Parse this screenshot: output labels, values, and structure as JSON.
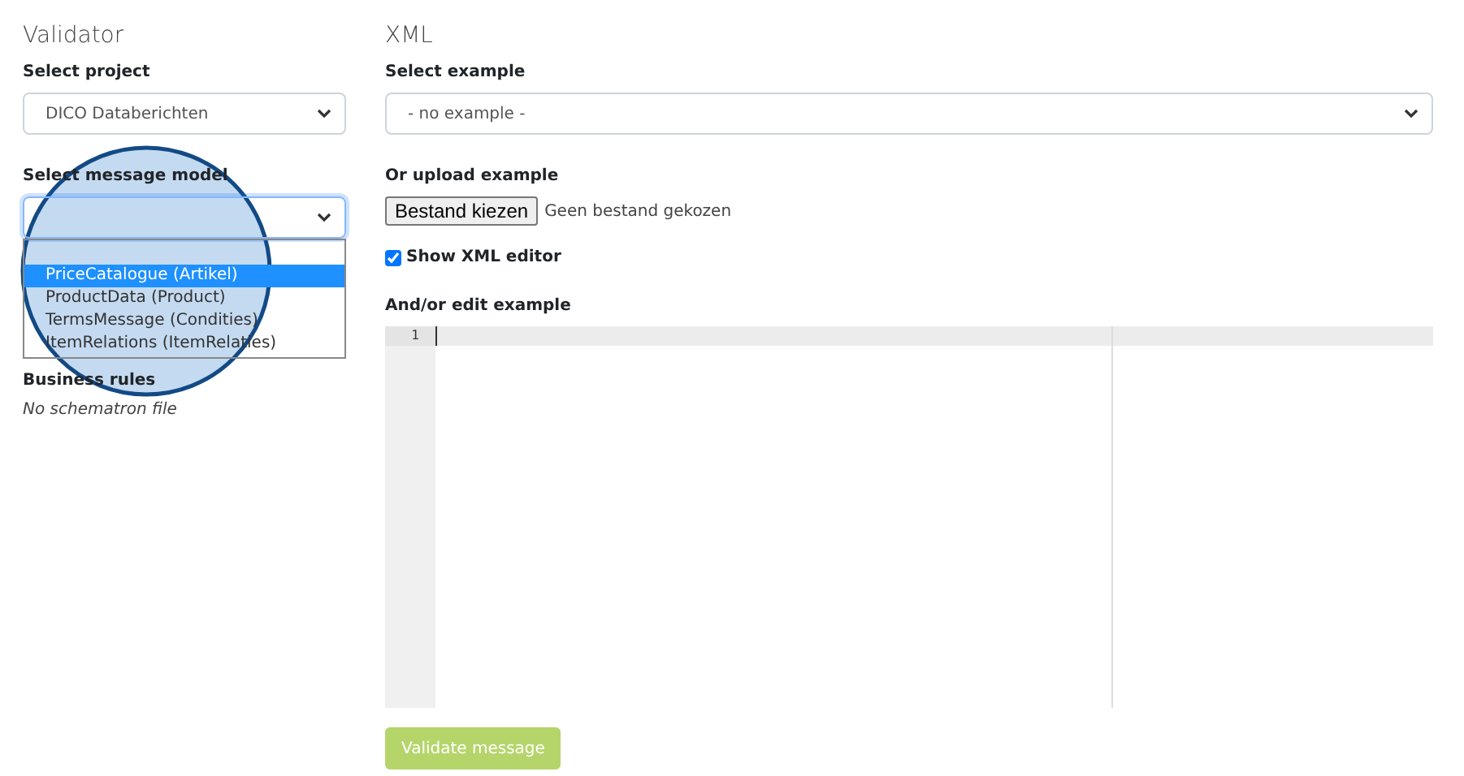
{
  "validator": {
    "title": "Validator",
    "project": {
      "label": "Select project",
      "value": "DICO Databerichten"
    },
    "message_model": {
      "label": "Select message model",
      "expanded": true,
      "options": [
        {
          "selected": false
        },
        {
          "label": "PriceCatalogue (Artikel)",
          "selected": true
        },
        {
          "label": "ProductData (Product)",
          "selected": false
        },
        {
          "label": "TermsMessage (Condities)",
          "selected": false
        },
        {
          "label": "ItemRelations (ItemRelaties)",
          "selected": false
        }
      ]
    },
    "business_rules": {
      "label": "Business rules",
      "value": "No schematron file"
    }
  },
  "xml": {
    "title": "XML",
    "example": {
      "label": "Select example",
      "value": "- no example -"
    },
    "upload": {
      "label": "Or upload example",
      "button": "Bestand kiezen",
      "status": "Geen bestand gekozen"
    },
    "show_editor": {
      "label": "Show XML editor",
      "checked": true
    },
    "editor": {
      "label": "And/or edit example",
      "line_numbers": [
        "1"
      ]
    },
    "validate_button": {
      "label": "Validate message",
      "disabled": true
    }
  }
}
